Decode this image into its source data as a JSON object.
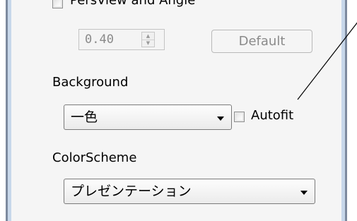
{
  "perspective": {
    "checkbox_label": "PersView and Angle",
    "checked": false,
    "angle_value": "0.40",
    "default_button_label": "Default"
  },
  "background": {
    "label": "Background",
    "selected": "一色",
    "autofit_label": "Autofit",
    "autofit_checked": false
  },
  "colorscheme": {
    "label": "ColorScheme",
    "selected": "プレゼンテーション"
  },
  "icons": {
    "spin_up": "chevron-up-icon",
    "spin_down": "chevron-down-icon",
    "combo_arrow": "chevron-down-icon"
  },
  "colors": {
    "panel_background": "#f5f5f5",
    "frame_border": "#7d8a9e",
    "frame_inner": "#c7d7ea",
    "disabled_text": "#8a8a8a"
  }
}
